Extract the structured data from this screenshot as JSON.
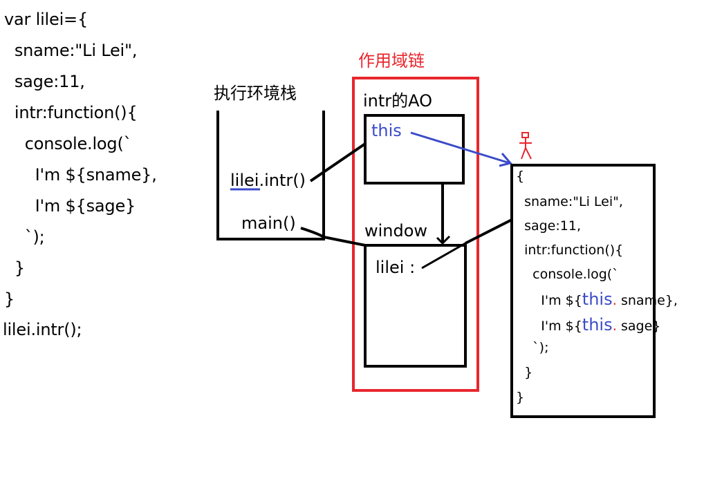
{
  "code": {
    "lines": [
      "var lilei={",
      "  sname:\"Li Lei\",",
      "  sage:11,",
      "  intr:function(){",
      "    console.log(`",
      "      I'm ${sname},",
      "      I'm ${sage}",
      "    `);",
      "  }",
      "}",
      "lilei.intr();"
    ]
  },
  "stack": {
    "title": "执行环境栈",
    "frames": [
      "lilei.intr()",
      "main()"
    ]
  },
  "scope_chain": {
    "title": "作用域链",
    "ao_title": "intr的AO",
    "ao_this": "this",
    "window_title": "window",
    "window_var": "lilei :"
  },
  "object": {
    "lines_plain": [
      "{",
      "  sname:\"Li Lei\",",
      "  sage:11,",
      "  intr:function(){",
      "    console.log(`"
    ],
    "line_sname_prefix": "      I'm ${",
    "line_sname_this": "this",
    "line_sname_dot": ".",
    "line_sname_suffix": " sname},",
    "line_sage_prefix": "      I'm ${",
    "line_sage_this": "this",
    "line_sage_dot": ".",
    "line_sage_suffix": " sage}",
    "lines_tail": [
      "    `);",
      "  }",
      "}"
    ]
  },
  "colors": {
    "blue": "#3b4bc8",
    "red": "#e8262d",
    "black": "#000000"
  },
  "icons": [
    "person-doodle-icon"
  ]
}
